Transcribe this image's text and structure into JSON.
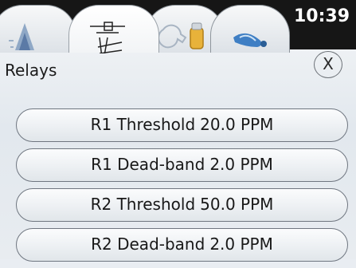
{
  "status": {
    "clock": "10:39"
  },
  "tabs": [
    {
      "icon": "level-graph-icon",
      "active": false
    },
    {
      "icon": "sliders-settings-icon",
      "active": true
    },
    {
      "icon": "tools-icon",
      "active": false
    },
    {
      "icon": "sensor-probe-icon",
      "active": false
    }
  ],
  "page": {
    "title": "Relays",
    "close_label": "X"
  },
  "relays": [
    {
      "label": "R1 Threshold",
      "value": "20.0 PPM"
    },
    {
      "label": "R1 Dead-band",
      "value": "2.0 PPM"
    },
    {
      "label": "R2 Threshold",
      "value": "50.0 PPM"
    },
    {
      "label": "R2 Dead-band",
      "value": "2.0 PPM"
    }
  ]
}
